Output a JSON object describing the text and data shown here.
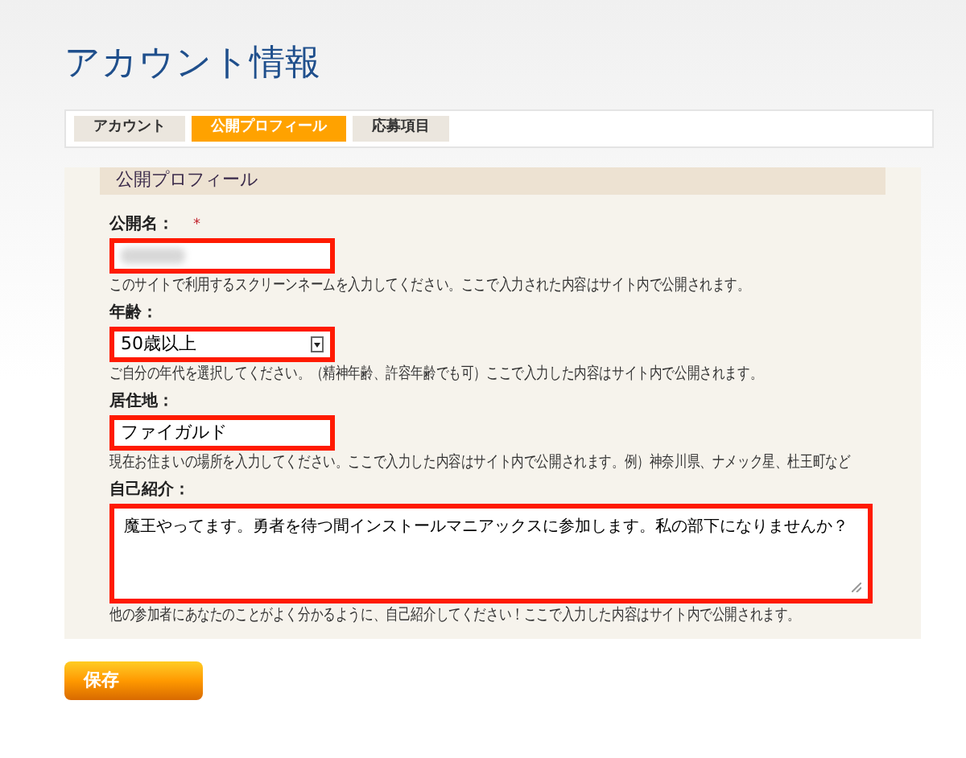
{
  "title": "アカウント情報",
  "tabs": [
    {
      "label": "アカウント",
      "selected": false
    },
    {
      "label": "公開プロフィール",
      "selected": true
    },
    {
      "label": "応募項目",
      "selected": false
    }
  ],
  "section_title": "公開プロフィール",
  "fields": [
    {
      "kind": "text",
      "label": "公開名：",
      "required_mark": "*",
      "redacted": true,
      "hint": "このサイトで利用するスクリーンネームを入力してください。ここで入力された内容はサイト内で公開されます。"
    },
    {
      "kind": "select",
      "label": "年齢：",
      "value": "50歳以上",
      "hint": "ご自分の年代を選択してください。（精神年齢、許容年齢でも可）ここで入力した内容はサイト内で公開されます。"
    },
    {
      "kind": "text",
      "label": "居住地：",
      "value": "ファイガルド",
      "hint": "現在お住まいの場所を入力してください。ここで入力した内容はサイト内で公開されます。例）神奈川県、ナメック星、杜王町など"
    },
    {
      "kind": "textarea",
      "label": "自己紹介：",
      "value": "魔王やってます。勇者を待つ間インストールマニアックスに参加します。私の部下になりませんか？",
      "hint": "他の参加者にあなたのことがよく分かるように、自己紹介してください！ここで入力した内容はサイト内で公開されます。"
    }
  ],
  "save_button": "保存"
}
